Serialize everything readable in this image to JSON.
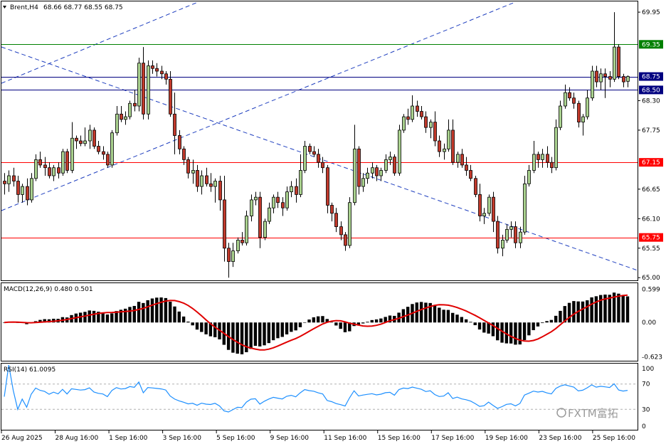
{
  "chart_data": {
    "type": "candlestick",
    "header": {
      "symbol": "Brent,H4",
      "ohlc": "68.66 68.77 68.55 68.75"
    },
    "price_axis": {
      "ticks": [
        "69.95",
        "68.30",
        "67.75",
        "66.65",
        "66.10",
        "65.55",
        "65.00"
      ],
      "ylim": [
        64.95,
        70.15
      ]
    },
    "levels": [
      {
        "label": "69.35",
        "value": 69.35,
        "color": "#008000"
      },
      {
        "label": "68.75",
        "value": 68.75,
        "color": "#000080"
      },
      {
        "label": "68.50",
        "value": 68.5,
        "color": "#000080"
      },
      {
        "label": "67.15",
        "value": 67.15,
        "color": "#ff0000"
      },
      {
        "label": "65.75",
        "value": 65.75,
        "color": "#ff0000"
      }
    ],
    "time_axis": {
      "ticks": [
        "26 Aug 2025",
        "28 Aug 16:00",
        "1 Sep 16:00",
        "3 Sep 16:00",
        "5 Sep 16:00",
        "9 Sep 16:00",
        "11 Sep 16:00",
        "15 Sep 16:00",
        "17 Sep 16:00",
        "19 Sep 16:00",
        "23 Sep 16:00",
        "25 Sep 16:00"
      ]
    },
    "candles": [
      {
        "o": 66.8,
        "h": 66.95,
        "l": 66.55,
        "c": 66.75
      },
      {
        "o": 66.75,
        "h": 67.0,
        "l": 66.6,
        "c": 66.9
      },
      {
        "o": 66.9,
        "h": 67.05,
        "l": 66.7,
        "c": 66.8
      },
      {
        "o": 66.8,
        "h": 66.9,
        "l": 66.4,
        "c": 66.55
      },
      {
        "o": 66.55,
        "h": 66.75,
        "l": 66.4,
        "c": 66.7
      },
      {
        "o": 66.7,
        "h": 66.85,
        "l": 66.35,
        "c": 66.45
      },
      {
        "o": 66.45,
        "h": 66.95,
        "l": 66.4,
        "c": 66.85
      },
      {
        "o": 66.85,
        "h": 67.3,
        "l": 66.8,
        "c": 67.2
      },
      {
        "o": 67.2,
        "h": 67.35,
        "l": 67.05,
        "c": 67.1
      },
      {
        "o": 67.1,
        "h": 67.25,
        "l": 66.9,
        "c": 67.05
      },
      {
        "o": 67.05,
        "h": 67.15,
        "l": 66.85,
        "c": 66.9
      },
      {
        "o": 66.9,
        "h": 67.1,
        "l": 66.8,
        "c": 67.05
      },
      {
        "o": 67.05,
        "h": 67.15,
        "l": 66.85,
        "c": 66.95
      },
      {
        "o": 66.95,
        "h": 67.4,
        "l": 66.9,
        "c": 67.35
      },
      {
        "o": 67.35,
        "h": 67.4,
        "l": 66.95,
        "c": 67.0
      },
      {
        "o": 67.0,
        "h": 67.9,
        "l": 66.95,
        "c": 67.6
      },
      {
        "o": 67.6,
        "h": 67.65,
        "l": 67.4,
        "c": 67.55
      },
      {
        "o": 67.55,
        "h": 67.65,
        "l": 67.45,
        "c": 67.5
      },
      {
        "o": 67.5,
        "h": 67.8,
        "l": 67.45,
        "c": 67.55
      },
      {
        "o": 67.55,
        "h": 67.85,
        "l": 67.4,
        "c": 67.75
      },
      {
        "o": 67.75,
        "h": 67.8,
        "l": 67.4,
        "c": 67.45
      },
      {
        "o": 67.45,
        "h": 67.55,
        "l": 67.3,
        "c": 67.35
      },
      {
        "o": 67.35,
        "h": 67.45,
        "l": 67.2,
        "c": 67.3
      },
      {
        "o": 67.3,
        "h": 67.35,
        "l": 67.05,
        "c": 67.1
      },
      {
        "o": 67.1,
        "h": 67.75,
        "l": 67.05,
        "c": 67.7
      },
      {
        "o": 67.7,
        "h": 68.2,
        "l": 67.65,
        "c": 68.05
      },
      {
        "o": 68.05,
        "h": 68.2,
        "l": 67.9,
        "c": 67.95
      },
      {
        "o": 67.95,
        "h": 68.1,
        "l": 67.85,
        "c": 68.0
      },
      {
        "o": 68.0,
        "h": 68.3,
        "l": 67.95,
        "c": 68.25
      },
      {
        "o": 68.25,
        "h": 68.5,
        "l": 68.1,
        "c": 68.2
      },
      {
        "o": 68.2,
        "h": 69.1,
        "l": 68.1,
        "c": 69.0
      },
      {
        "o": 69.0,
        "h": 69.3,
        "l": 67.95,
        "c": 68.05
      },
      {
        "o": 68.05,
        "h": 69.05,
        "l": 67.95,
        "c": 68.95
      },
      {
        "o": 68.95,
        "h": 69.05,
        "l": 68.8,
        "c": 68.9
      },
      {
        "o": 68.9,
        "h": 69.0,
        "l": 68.75,
        "c": 68.85
      },
      {
        "o": 68.85,
        "h": 68.95,
        "l": 68.7,
        "c": 68.8
      },
      {
        "o": 68.8,
        "h": 68.85,
        "l": 68.6,
        "c": 68.7
      },
      {
        "o": 68.7,
        "h": 68.85,
        "l": 68.0,
        "c": 68.05
      },
      {
        "o": 68.05,
        "h": 68.45,
        "l": 67.3,
        "c": 67.65
      },
      {
        "o": 67.65,
        "h": 67.75,
        "l": 67.3,
        "c": 67.4
      },
      {
        "o": 67.4,
        "h": 67.45,
        "l": 67.1,
        "c": 67.2
      },
      {
        "o": 67.2,
        "h": 67.25,
        "l": 66.85,
        "c": 66.95
      },
      {
        "o": 66.95,
        "h": 67.2,
        "l": 66.75,
        "c": 67.0
      },
      {
        "o": 67.0,
        "h": 67.1,
        "l": 66.6,
        "c": 66.7
      },
      {
        "o": 66.7,
        "h": 67.0,
        "l": 66.55,
        "c": 66.9
      },
      {
        "o": 66.9,
        "h": 67.05,
        "l": 66.7,
        "c": 66.75
      },
      {
        "o": 66.75,
        "h": 66.95,
        "l": 66.6,
        "c": 66.7
      },
      {
        "o": 66.7,
        "h": 66.85,
        "l": 66.4,
        "c": 66.8
      },
      {
        "o": 66.8,
        "h": 66.9,
        "l": 66.25,
        "c": 66.45
      },
      {
        "o": 66.45,
        "h": 66.9,
        "l": 65.3,
        "c": 65.55
      },
      {
        "o": 65.55,
        "h": 65.65,
        "l": 65.0,
        "c": 65.3
      },
      {
        "o": 65.3,
        "h": 65.65,
        "l": 65.2,
        "c": 65.5
      },
      {
        "o": 65.5,
        "h": 65.75,
        "l": 65.45,
        "c": 65.7
      },
      {
        "o": 65.7,
        "h": 65.85,
        "l": 65.6,
        "c": 65.65
      },
      {
        "o": 65.65,
        "h": 66.25,
        "l": 65.6,
        "c": 66.15
      },
      {
        "o": 66.15,
        "h": 66.55,
        "l": 66.05,
        "c": 66.45
      },
      {
        "o": 66.45,
        "h": 66.6,
        "l": 66.35,
        "c": 66.5
      },
      {
        "o": 66.5,
        "h": 66.6,
        "l": 65.55,
        "c": 65.75
      },
      {
        "o": 65.75,
        "h": 66.1,
        "l": 65.7,
        "c": 66.05
      },
      {
        "o": 66.05,
        "h": 66.4,
        "l": 66.0,
        "c": 66.3
      },
      {
        "o": 66.3,
        "h": 66.55,
        "l": 66.2,
        "c": 66.5
      },
      {
        "o": 66.5,
        "h": 66.6,
        "l": 66.3,
        "c": 66.4
      },
      {
        "o": 66.4,
        "h": 66.5,
        "l": 66.15,
        "c": 66.3
      },
      {
        "o": 66.3,
        "h": 66.7,
        "l": 66.25,
        "c": 66.6
      },
      {
        "o": 66.6,
        "h": 66.8,
        "l": 66.5,
        "c": 66.7
      },
      {
        "o": 66.7,
        "h": 66.85,
        "l": 66.4,
        "c": 66.55
      },
      {
        "o": 66.55,
        "h": 67.3,
        "l": 66.5,
        "c": 67.0
      },
      {
        "o": 67.0,
        "h": 67.55,
        "l": 66.95,
        "c": 67.45
      },
      {
        "o": 67.45,
        "h": 67.5,
        "l": 67.3,
        "c": 67.35
      },
      {
        "o": 67.35,
        "h": 67.45,
        "l": 67.25,
        "c": 67.3
      },
      {
        "o": 67.3,
        "h": 67.4,
        "l": 67.05,
        "c": 67.15
      },
      {
        "o": 67.15,
        "h": 67.25,
        "l": 66.95,
        "c": 67.05
      },
      {
        "o": 67.05,
        "h": 67.1,
        "l": 66.2,
        "c": 66.35
      },
      {
        "o": 66.35,
        "h": 66.4,
        "l": 66.05,
        "c": 66.2
      },
      {
        "o": 66.2,
        "h": 66.3,
        "l": 65.85,
        "c": 65.95
      },
      {
        "o": 65.95,
        "h": 66.05,
        "l": 65.7,
        "c": 65.8
      },
      {
        "o": 65.8,
        "h": 65.85,
        "l": 65.5,
        "c": 65.6
      },
      {
        "o": 65.6,
        "h": 66.5,
        "l": 65.55,
        "c": 66.4
      },
      {
        "o": 66.4,
        "h": 67.85,
        "l": 66.35,
        "c": 67.4
      },
      {
        "o": 67.4,
        "h": 67.45,
        "l": 66.55,
        "c": 66.7
      },
      {
        "o": 66.7,
        "h": 66.95,
        "l": 66.6,
        "c": 66.85
      },
      {
        "o": 66.85,
        "h": 67.05,
        "l": 66.75,
        "c": 66.95
      },
      {
        "o": 66.95,
        "h": 67.15,
        "l": 66.85,
        "c": 67.05
      },
      {
        "o": 67.05,
        "h": 67.1,
        "l": 66.8,
        "c": 66.9
      },
      {
        "o": 66.9,
        "h": 67.05,
        "l": 66.8,
        "c": 67.0
      },
      {
        "o": 67.0,
        "h": 67.3,
        "l": 66.95,
        "c": 67.2
      },
      {
        "o": 67.2,
        "h": 67.35,
        "l": 67.1,
        "c": 67.25
      },
      {
        "o": 67.25,
        "h": 67.3,
        "l": 66.9,
        "c": 66.95
      },
      {
        "o": 66.95,
        "h": 67.85,
        "l": 66.9,
        "c": 67.75
      },
      {
        "o": 67.75,
        "h": 68.05,
        "l": 67.7,
        "c": 68.0
      },
      {
        "o": 68.0,
        "h": 68.15,
        "l": 67.85,
        "c": 67.95
      },
      {
        "o": 67.95,
        "h": 68.4,
        "l": 67.9,
        "c": 68.2
      },
      {
        "o": 68.2,
        "h": 68.3,
        "l": 68.0,
        "c": 68.1
      },
      {
        "o": 68.1,
        "h": 68.2,
        "l": 67.95,
        "c": 68.0
      },
      {
        "o": 68.0,
        "h": 68.1,
        "l": 67.7,
        "c": 67.8
      },
      {
        "o": 67.8,
        "h": 67.95,
        "l": 67.6,
        "c": 67.9
      },
      {
        "o": 67.9,
        "h": 68.1,
        "l": 67.45,
        "c": 67.55
      },
      {
        "o": 67.55,
        "h": 67.65,
        "l": 67.25,
        "c": 67.35
      },
      {
        "o": 67.35,
        "h": 67.5,
        "l": 67.2,
        "c": 67.4
      },
      {
        "o": 67.4,
        "h": 67.95,
        "l": 67.35,
        "c": 67.75
      },
      {
        "o": 67.75,
        "h": 67.95,
        "l": 67.1,
        "c": 67.15
      },
      {
        "o": 67.15,
        "h": 67.35,
        "l": 67.05,
        "c": 67.3
      },
      {
        "o": 67.3,
        "h": 67.4,
        "l": 67.05,
        "c": 67.1
      },
      {
        "o": 67.1,
        "h": 67.25,
        "l": 66.9,
        "c": 67.0
      },
      {
        "o": 67.0,
        "h": 67.1,
        "l": 66.8,
        "c": 66.85
      },
      {
        "o": 66.85,
        "h": 66.9,
        "l": 66.5,
        "c": 66.55
      },
      {
        "o": 66.55,
        "h": 66.75,
        "l": 66.05,
        "c": 66.15
      },
      {
        "o": 66.15,
        "h": 66.3,
        "l": 66.0,
        "c": 66.2
      },
      {
        "o": 66.2,
        "h": 66.55,
        "l": 66.15,
        "c": 66.5
      },
      {
        "o": 66.5,
        "h": 66.6,
        "l": 65.85,
        "c": 66.05
      },
      {
        "o": 66.05,
        "h": 66.15,
        "l": 65.45,
        "c": 65.55
      },
      {
        "o": 65.55,
        "h": 65.8,
        "l": 65.4,
        "c": 65.7
      },
      {
        "o": 65.7,
        "h": 66.0,
        "l": 65.65,
        "c": 65.9
      },
      {
        "o": 65.9,
        "h": 66.05,
        "l": 65.75,
        "c": 65.95
      },
      {
        "o": 65.95,
        "h": 66.05,
        "l": 65.55,
        "c": 65.65
      },
      {
        "o": 65.65,
        "h": 65.95,
        "l": 65.55,
        "c": 65.85
      },
      {
        "o": 65.85,
        "h": 66.9,
        "l": 65.8,
        "c": 66.75
      },
      {
        "o": 66.75,
        "h": 67.1,
        "l": 66.7,
        "c": 67.0
      },
      {
        "o": 67.0,
        "h": 67.55,
        "l": 66.95,
        "c": 67.3
      },
      {
        "o": 67.3,
        "h": 67.35,
        "l": 67.05,
        "c": 67.2
      },
      {
        "o": 67.2,
        "h": 67.4,
        "l": 67.05,
        "c": 67.3
      },
      {
        "o": 67.3,
        "h": 67.45,
        "l": 67.05,
        "c": 67.15
      },
      {
        "o": 67.15,
        "h": 67.25,
        "l": 66.95,
        "c": 67.05
      },
      {
        "o": 67.05,
        "h": 67.95,
        "l": 67.0,
        "c": 67.8
      },
      {
        "o": 67.8,
        "h": 68.3,
        "l": 67.75,
        "c": 68.2
      },
      {
        "o": 68.2,
        "h": 68.6,
        "l": 68.15,
        "c": 68.45
      },
      {
        "o": 68.45,
        "h": 68.55,
        "l": 68.3,
        "c": 68.35
      },
      {
        "o": 68.35,
        "h": 68.45,
        "l": 68.15,
        "c": 68.25
      },
      {
        "o": 68.25,
        "h": 68.3,
        "l": 67.8,
        "c": 67.9
      },
      {
        "o": 67.9,
        "h": 68.05,
        "l": 67.65,
        "c": 68.0
      },
      {
        "o": 68.0,
        "h": 68.5,
        "l": 67.95,
        "c": 68.35
      },
      {
        "o": 68.35,
        "h": 68.95,
        "l": 68.3,
        "c": 68.85
      },
      {
        "o": 68.85,
        "h": 68.95,
        "l": 68.55,
        "c": 68.65
      },
      {
        "o": 68.65,
        "h": 68.9,
        "l": 68.5,
        "c": 68.8
      },
      {
        "o": 68.8,
        "h": 68.9,
        "l": 68.35,
        "c": 68.75
      },
      {
        "o": 68.75,
        "h": 68.85,
        "l": 68.55,
        "c": 68.7
      },
      {
        "o": 68.7,
        "h": 69.95,
        "l": 68.65,
        "c": 69.3
      },
      {
        "o": 69.3,
        "h": 69.35,
        "l": 68.7,
        "c": 68.75
      },
      {
        "o": 68.75,
        "h": 68.8,
        "l": 68.55,
        "c": 68.65
      },
      {
        "o": 68.66,
        "h": 68.77,
        "l": 68.55,
        "c": 68.75
      }
    ],
    "macd": {
      "label": "MACD(12,26,9) 0.480 0.501",
      "ticks": [
        "0.599",
        "0.00",
        "-0.623"
      ],
      "ylim": [
        -0.68,
        0.66
      ]
    },
    "rsi": {
      "label": "RSI(14) 61.0095",
      "ticks": [
        "100",
        "70",
        "30",
        "0"
      ],
      "levels": [
        70,
        30
      ],
      "ylim": [
        0,
        100
      ]
    },
    "watermark": "FXTM富拓"
  }
}
